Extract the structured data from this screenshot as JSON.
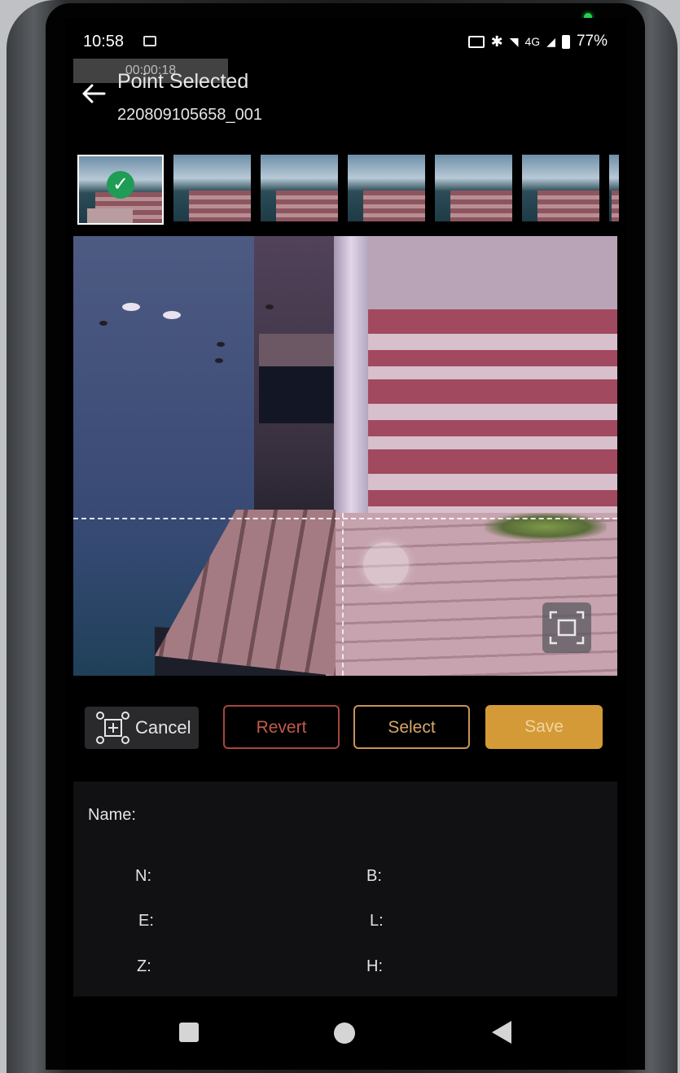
{
  "status_bar": {
    "time": "10:58",
    "network": "4G",
    "battery": "77%"
  },
  "overlay": {
    "duration": "00:00:18"
  },
  "header": {
    "title": "Point Selected",
    "subtitle": "220809105658_001"
  },
  "thumbnails": {
    "count_visible": 7,
    "selected_index": 0
  },
  "actions": {
    "cancel_label": "Cancel",
    "revert_label": "Revert",
    "select_label": "Select",
    "save_label": "Save"
  },
  "info": {
    "name_label": "Name:",
    "n_label": "N:",
    "e_label": "E:",
    "z_label": "Z:",
    "b_label": "B:",
    "l_label": "L:",
    "h_label": "H:"
  },
  "colors": {
    "accent": "#d49a38",
    "revert": "#a8463a",
    "select": "#c99357",
    "check": "#1f9c55"
  }
}
